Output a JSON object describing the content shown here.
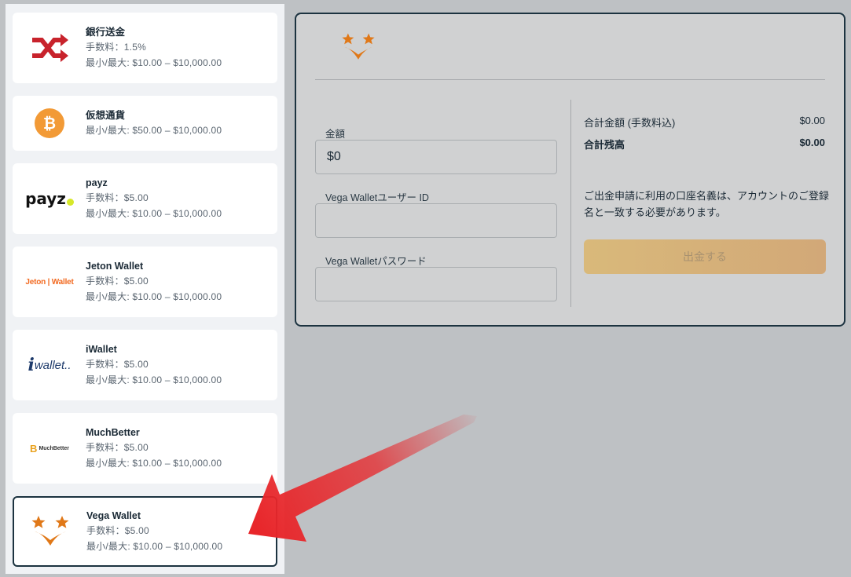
{
  "methods": [
    {
      "name": "銀行送金",
      "fee": "手数料：1.5%",
      "range": "最小/最大: $10.00 – $10,000.00",
      "icon": "shuffle-icon"
    },
    {
      "name": "仮想通貨",
      "range": "最小/最大: $50.00 – $10,000.00",
      "icon": "bitcoin-icon"
    },
    {
      "name": "payz",
      "fee": "手数料：$5.00",
      "range": "最小/最大: $10.00 – $10,000.00",
      "logo_text": "payz",
      "icon": "payz-logo"
    },
    {
      "name": "Jeton Wallet",
      "fee": "手数料：$5.00",
      "range": "最小/最大: $10.00 – $10,000.00",
      "logo_text": "Jeton | Wallet",
      "icon": "jeton-logo"
    },
    {
      "name": "iWallet",
      "fee": "手数料：$5.00",
      "range": "最小/最大: $10.00 – $10,000.00",
      "logo_text": "wallet..",
      "icon": "iwallet-logo"
    },
    {
      "name": "MuchBetter",
      "fee": "手数料：$5.00",
      "range": "最小/最大: $10.00 – $10,000.00",
      "logo_text": "MuchBetter",
      "icon": "muchbetter-logo"
    },
    {
      "name": "Vega Wallet",
      "fee": "手数料：$5.00",
      "range": "最小/最大: $10.00 – $10,000.00",
      "icon": "vega-logo",
      "selected": true
    }
  ],
  "form": {
    "amount_label": "金額",
    "amount_value": "$0",
    "user_id_label": "Vega Walletユーザー ID",
    "user_id_value": "",
    "password_label": "Vega Walletパスワード",
    "password_value": ""
  },
  "summary": {
    "total_label": "合計金額 (手数料込)",
    "total_value": "$0.00",
    "balance_label": "合計残高",
    "balance_value": "$0.00",
    "notice": "ご出金申請に利用の口座名義は、アカウントのご登録名と一致する必要があります。",
    "submit_label": "出金する"
  },
  "colors": {
    "accent_orange": "#e07818",
    "selected_border": "#1c3340",
    "arrow_red": "#e8262a",
    "submit_bg": "#d9b97a"
  }
}
